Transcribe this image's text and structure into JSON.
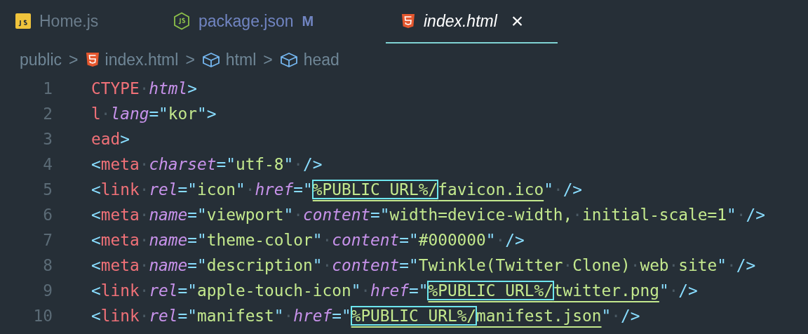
{
  "tabs": [
    {
      "label": "Home.js",
      "kind": "javascript",
      "selected": false
    },
    {
      "label": "package.json",
      "kind": "json",
      "selected": false,
      "badge": "M"
    },
    {
      "label": "index.html",
      "kind": "html",
      "selected": true,
      "close": "×"
    }
  ],
  "breadcrumbs": [
    {
      "label": "public",
      "kind": "folder"
    },
    {
      "label": "index.html",
      "kind": "file"
    },
    {
      "label": "html",
      "kind": "element"
    },
    {
      "label": "head",
      "kind": "element"
    }
  ],
  "breadcrumb_separator": ">",
  "lines": [
    {
      "number": "1",
      "tokens": [
        {
          "kind": "tag",
          "text": "CTYPE"
        },
        {
          "kind": "ws",
          "text": "·"
        },
        {
          "kind": "attr",
          "text": "html"
        },
        {
          "kind": "p",
          "text": ">"
        }
      ]
    },
    {
      "number": "2",
      "tokens": [
        {
          "kind": "tag",
          "text": "l"
        },
        {
          "kind": "ws",
          "text": "·"
        },
        {
          "kind": "attr",
          "text": "lang"
        },
        {
          "kind": "p",
          "text": "=\""
        },
        {
          "kind": "str",
          "text": "kor"
        },
        {
          "kind": "p",
          "text": "\">"
        }
      ]
    },
    {
      "number": "3",
      "tokens": [
        {
          "kind": "tag",
          "text": "ead"
        },
        {
          "kind": "p",
          "text": ">"
        }
      ]
    },
    {
      "number": "4",
      "tokens": [
        {
          "kind": "p",
          "text": "<"
        },
        {
          "kind": "tag",
          "text": "meta"
        },
        {
          "kind": "ws",
          "text": "·"
        },
        {
          "kind": "attr",
          "text": "charset"
        },
        {
          "kind": "p",
          "text": "=\""
        },
        {
          "kind": "str",
          "text": "utf-8"
        },
        {
          "kind": "p",
          "text": "\""
        },
        {
          "kind": "ws",
          "text": "·"
        },
        {
          "kind": "p",
          "text": "/>"
        }
      ]
    },
    {
      "number": "5",
      "tokens": [
        {
          "kind": "p",
          "text": "<"
        },
        {
          "kind": "tag",
          "text": "link"
        },
        {
          "kind": "ws",
          "text": "·"
        },
        {
          "kind": "attr",
          "text": "rel"
        },
        {
          "kind": "p",
          "text": "=\""
        },
        {
          "kind": "str",
          "text": "icon"
        },
        {
          "kind": "p",
          "text": "\""
        },
        {
          "kind": "ws",
          "text": "·"
        },
        {
          "kind": "attr",
          "text": "href"
        },
        {
          "kind": "p",
          "text": "=\""
        },
        {
          "kind": "url",
          "text": "%PUBLIC_URL%/"
        },
        {
          "kind": "link",
          "text": "favicon.ico"
        },
        {
          "kind": "p",
          "text": "\""
        },
        {
          "kind": "ws",
          "text": "·"
        },
        {
          "kind": "p",
          "text": "/>"
        }
      ]
    },
    {
      "number": "6",
      "tokens": [
        {
          "kind": "p",
          "text": "<"
        },
        {
          "kind": "tag",
          "text": "meta"
        },
        {
          "kind": "ws",
          "text": "·"
        },
        {
          "kind": "attr",
          "text": "name"
        },
        {
          "kind": "p",
          "text": "=\""
        },
        {
          "kind": "str",
          "text": "viewport"
        },
        {
          "kind": "p",
          "text": "\""
        },
        {
          "kind": "ws",
          "text": "·"
        },
        {
          "kind": "attr",
          "text": "content"
        },
        {
          "kind": "p",
          "text": "=\""
        },
        {
          "kind": "str",
          "text": "width=device-width,"
        },
        {
          "kind": "ws",
          "text": "·"
        },
        {
          "kind": "str",
          "text": "initial-scale=1"
        },
        {
          "kind": "p",
          "text": "\""
        },
        {
          "kind": "ws",
          "text": "·"
        },
        {
          "kind": "p",
          "text": "/>"
        }
      ]
    },
    {
      "number": "7",
      "tokens": [
        {
          "kind": "p",
          "text": "<"
        },
        {
          "kind": "tag",
          "text": "meta"
        },
        {
          "kind": "ws",
          "text": "·"
        },
        {
          "kind": "attr",
          "text": "name"
        },
        {
          "kind": "p",
          "text": "=\""
        },
        {
          "kind": "str",
          "text": "theme-color"
        },
        {
          "kind": "p",
          "text": "\""
        },
        {
          "kind": "ws",
          "text": "·"
        },
        {
          "kind": "attr",
          "text": "content"
        },
        {
          "kind": "p",
          "text": "=\""
        },
        {
          "kind": "str",
          "text": "#000000"
        },
        {
          "kind": "p",
          "text": "\""
        },
        {
          "kind": "ws",
          "text": "·"
        },
        {
          "kind": "p",
          "text": "/>"
        }
      ]
    },
    {
      "number": "8",
      "tokens": [
        {
          "kind": "p",
          "text": "<"
        },
        {
          "kind": "tag",
          "text": "meta"
        },
        {
          "kind": "ws",
          "text": "·"
        },
        {
          "kind": "attr",
          "text": "name"
        },
        {
          "kind": "p",
          "text": "=\""
        },
        {
          "kind": "str",
          "text": "description"
        },
        {
          "kind": "p",
          "text": "\""
        },
        {
          "kind": "ws",
          "text": "·"
        },
        {
          "kind": "attr",
          "text": "content"
        },
        {
          "kind": "p",
          "text": "=\""
        },
        {
          "kind": "str",
          "text": "Twinkle(Twitter"
        },
        {
          "kind": "ws",
          "text": "·"
        },
        {
          "kind": "str",
          "text": "Clone)"
        },
        {
          "kind": "ws",
          "text": "·"
        },
        {
          "kind": "str",
          "text": "web"
        },
        {
          "kind": "ws",
          "text": "·"
        },
        {
          "kind": "str",
          "text": "site"
        },
        {
          "kind": "p",
          "text": "\""
        },
        {
          "kind": "ws",
          "text": "·"
        },
        {
          "kind": "p",
          "text": "/>"
        }
      ]
    },
    {
      "number": "9",
      "tokens": [
        {
          "kind": "p",
          "text": "<"
        },
        {
          "kind": "tag",
          "text": "link"
        },
        {
          "kind": "ws",
          "text": "·"
        },
        {
          "kind": "attr",
          "text": "rel"
        },
        {
          "kind": "p",
          "text": "=\""
        },
        {
          "kind": "str",
          "text": "apple-touch-icon"
        },
        {
          "kind": "p",
          "text": "\""
        },
        {
          "kind": "ws",
          "text": "·"
        },
        {
          "kind": "attr",
          "text": "href"
        },
        {
          "kind": "p",
          "text": "=\""
        },
        {
          "kind": "url",
          "text": "%PUBLIC_URL%/"
        },
        {
          "kind": "link",
          "text": "twitter.png"
        },
        {
          "kind": "p",
          "text": "\""
        },
        {
          "kind": "ws",
          "text": "·"
        },
        {
          "kind": "p",
          "text": "/>"
        }
      ]
    },
    {
      "number": "10",
      "tokens": [
        {
          "kind": "p",
          "text": "<"
        },
        {
          "kind": "tag",
          "text": "link"
        },
        {
          "kind": "ws",
          "text": "·"
        },
        {
          "kind": "attr",
          "text": "rel"
        },
        {
          "kind": "p",
          "text": "=\""
        },
        {
          "kind": "str",
          "text": "manifest"
        },
        {
          "kind": "p",
          "text": "\""
        },
        {
          "kind": "ws",
          "text": "·"
        },
        {
          "kind": "attr",
          "text": "href"
        },
        {
          "kind": "p",
          "text": "=\""
        },
        {
          "kind": "url",
          "text": "%PUBLIC_URL%/"
        },
        {
          "kind": "link",
          "text": "manifest.json"
        },
        {
          "kind": "p",
          "text": "\""
        },
        {
          "kind": "ws",
          "text": "·"
        },
        {
          "kind": "p",
          "text": "/>"
        }
      ]
    }
  ]
}
